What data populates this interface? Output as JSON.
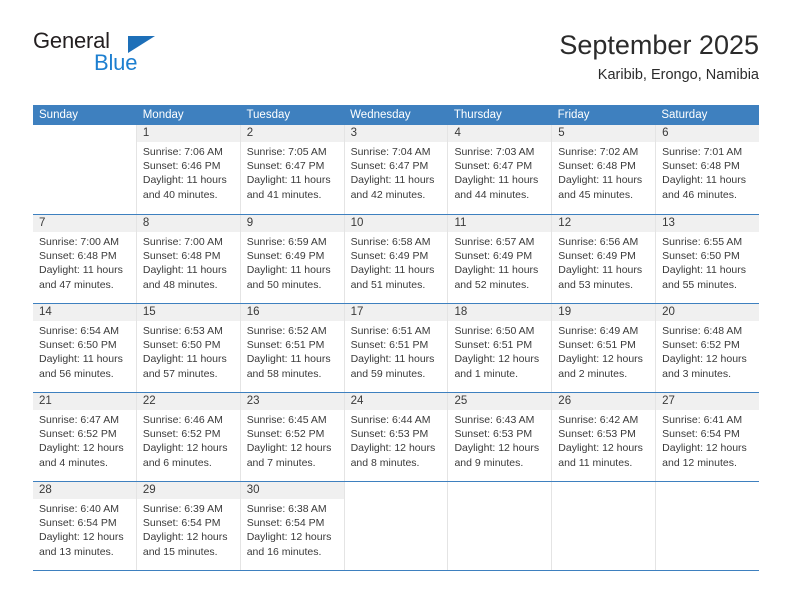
{
  "logo": {
    "word_one": "General",
    "word_two": "Blue",
    "triangle_icon": "triangle-icon",
    "accent_dark": "#1d6fb8",
    "accent_light": "#1d7fd0"
  },
  "header": {
    "title": "September 2025",
    "subtitle": "Karibib, Erongo, Namibia"
  },
  "colors": {
    "header_blue": "#3e80bf",
    "daynum_band": "#f0f0f0",
    "text": "#3a3a3a"
  },
  "weekdays": [
    "Sunday",
    "Monday",
    "Tuesday",
    "Wednesday",
    "Thursday",
    "Friday",
    "Saturday"
  ],
  "weeks": [
    [
      {
        "day": "",
        "sunrise": "",
        "sunset": "",
        "daylight": "",
        "empty": true
      },
      {
        "day": "1",
        "sunrise": "Sunrise: 7:06 AM",
        "sunset": "Sunset: 6:46 PM",
        "daylight": "Daylight: 11 hours and 40 minutes."
      },
      {
        "day": "2",
        "sunrise": "Sunrise: 7:05 AM",
        "sunset": "Sunset: 6:47 PM",
        "daylight": "Daylight: 11 hours and 41 minutes."
      },
      {
        "day": "3",
        "sunrise": "Sunrise: 7:04 AM",
        "sunset": "Sunset: 6:47 PM",
        "daylight": "Daylight: 11 hours and 42 minutes."
      },
      {
        "day": "4",
        "sunrise": "Sunrise: 7:03 AM",
        "sunset": "Sunset: 6:47 PM",
        "daylight": "Daylight: 11 hours and 44 minutes."
      },
      {
        "day": "5",
        "sunrise": "Sunrise: 7:02 AM",
        "sunset": "Sunset: 6:48 PM",
        "daylight": "Daylight: 11 hours and 45 minutes."
      },
      {
        "day": "6",
        "sunrise": "Sunrise: 7:01 AM",
        "sunset": "Sunset: 6:48 PM",
        "daylight": "Daylight: 11 hours and 46 minutes."
      }
    ],
    [
      {
        "day": "7",
        "sunrise": "Sunrise: 7:00 AM",
        "sunset": "Sunset: 6:48 PM",
        "daylight": "Daylight: 11 hours and 47 minutes."
      },
      {
        "day": "8",
        "sunrise": "Sunrise: 7:00 AM",
        "sunset": "Sunset: 6:48 PM",
        "daylight": "Daylight: 11 hours and 48 minutes."
      },
      {
        "day": "9",
        "sunrise": "Sunrise: 6:59 AM",
        "sunset": "Sunset: 6:49 PM",
        "daylight": "Daylight: 11 hours and 50 minutes."
      },
      {
        "day": "10",
        "sunrise": "Sunrise: 6:58 AM",
        "sunset": "Sunset: 6:49 PM",
        "daylight": "Daylight: 11 hours and 51 minutes."
      },
      {
        "day": "11",
        "sunrise": "Sunrise: 6:57 AM",
        "sunset": "Sunset: 6:49 PM",
        "daylight": "Daylight: 11 hours and 52 minutes."
      },
      {
        "day": "12",
        "sunrise": "Sunrise: 6:56 AM",
        "sunset": "Sunset: 6:49 PM",
        "daylight": "Daylight: 11 hours and 53 minutes."
      },
      {
        "day": "13",
        "sunrise": "Sunrise: 6:55 AM",
        "sunset": "Sunset: 6:50 PM",
        "daylight": "Daylight: 11 hours and 55 minutes."
      }
    ],
    [
      {
        "day": "14",
        "sunrise": "Sunrise: 6:54 AM",
        "sunset": "Sunset: 6:50 PM",
        "daylight": "Daylight: 11 hours and 56 minutes."
      },
      {
        "day": "15",
        "sunrise": "Sunrise: 6:53 AM",
        "sunset": "Sunset: 6:50 PM",
        "daylight": "Daylight: 11 hours and 57 minutes."
      },
      {
        "day": "16",
        "sunrise": "Sunrise: 6:52 AM",
        "sunset": "Sunset: 6:51 PM",
        "daylight": "Daylight: 11 hours and 58 minutes."
      },
      {
        "day": "17",
        "sunrise": "Sunrise: 6:51 AM",
        "sunset": "Sunset: 6:51 PM",
        "daylight": "Daylight: 11 hours and 59 minutes."
      },
      {
        "day": "18",
        "sunrise": "Sunrise: 6:50 AM",
        "sunset": "Sunset: 6:51 PM",
        "daylight": "Daylight: 12 hours and 1 minute."
      },
      {
        "day": "19",
        "sunrise": "Sunrise: 6:49 AM",
        "sunset": "Sunset: 6:51 PM",
        "daylight": "Daylight: 12 hours and 2 minutes."
      },
      {
        "day": "20",
        "sunrise": "Sunrise: 6:48 AM",
        "sunset": "Sunset: 6:52 PM",
        "daylight": "Daylight: 12 hours and 3 minutes."
      }
    ],
    [
      {
        "day": "21",
        "sunrise": "Sunrise: 6:47 AM",
        "sunset": "Sunset: 6:52 PM",
        "daylight": "Daylight: 12 hours and 4 minutes."
      },
      {
        "day": "22",
        "sunrise": "Sunrise: 6:46 AM",
        "sunset": "Sunset: 6:52 PM",
        "daylight": "Daylight: 12 hours and 6 minutes."
      },
      {
        "day": "23",
        "sunrise": "Sunrise: 6:45 AM",
        "sunset": "Sunset: 6:52 PM",
        "daylight": "Daylight: 12 hours and 7 minutes."
      },
      {
        "day": "24",
        "sunrise": "Sunrise: 6:44 AM",
        "sunset": "Sunset: 6:53 PM",
        "daylight": "Daylight: 12 hours and 8 minutes."
      },
      {
        "day": "25",
        "sunrise": "Sunrise: 6:43 AM",
        "sunset": "Sunset: 6:53 PM",
        "daylight": "Daylight: 12 hours and 9 minutes."
      },
      {
        "day": "26",
        "sunrise": "Sunrise: 6:42 AM",
        "sunset": "Sunset: 6:53 PM",
        "daylight": "Daylight: 12 hours and 11 minutes."
      },
      {
        "day": "27",
        "sunrise": "Sunrise: 6:41 AM",
        "sunset": "Sunset: 6:54 PM",
        "daylight": "Daylight: 12 hours and 12 minutes."
      }
    ],
    [
      {
        "day": "28",
        "sunrise": "Sunrise: 6:40 AM",
        "sunset": "Sunset: 6:54 PM",
        "daylight": "Daylight: 12 hours and 13 minutes."
      },
      {
        "day": "29",
        "sunrise": "Sunrise: 6:39 AM",
        "sunset": "Sunset: 6:54 PM",
        "daylight": "Daylight: 12 hours and 15 minutes."
      },
      {
        "day": "30",
        "sunrise": "Sunrise: 6:38 AM",
        "sunset": "Sunset: 6:54 PM",
        "daylight": "Daylight: 12 hours and 16 minutes."
      },
      {
        "day": "",
        "sunrise": "",
        "sunset": "",
        "daylight": "",
        "empty": true
      },
      {
        "day": "",
        "sunrise": "",
        "sunset": "",
        "daylight": "",
        "empty": true
      },
      {
        "day": "",
        "sunrise": "",
        "sunset": "",
        "daylight": "",
        "empty": true
      },
      {
        "day": "",
        "sunrise": "",
        "sunset": "",
        "daylight": "",
        "empty": true
      }
    ]
  ]
}
